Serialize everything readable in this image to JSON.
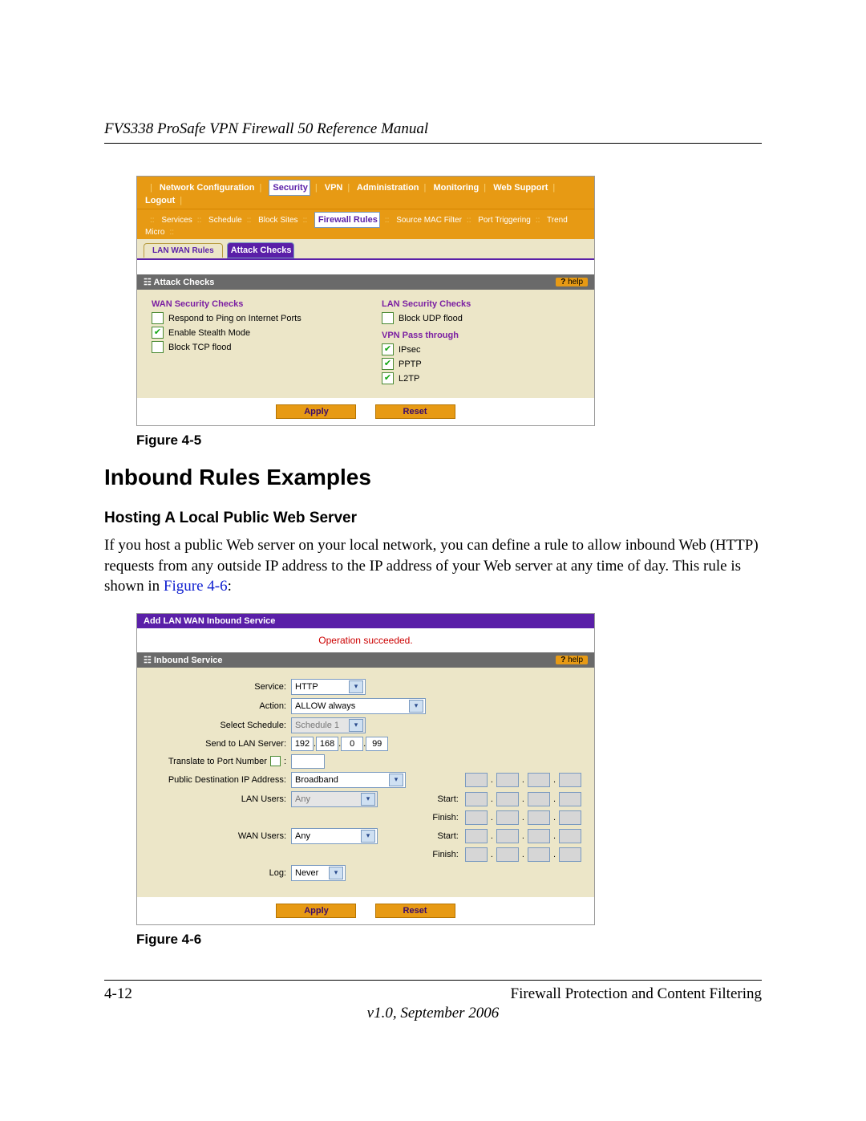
{
  "doc": {
    "running_head": "FVS338 ProSafe VPN Firewall 50 Reference Manual",
    "fig5_caption": "Figure 4-5",
    "section_head": "Inbound Rules Examples",
    "sub_head": "Hosting A Local Public Web Server",
    "body_text_pre": "If you host a public Web server on your local network, you can define a rule to allow inbound Web (HTTP) requests from any outside IP address to the IP address of your Web server at any time of day. This rule is shown in ",
    "body_text_xref": "Figure 4-6",
    "body_text_post": ":",
    "fig6_caption": "Figure 4-6",
    "pagenum": "4-12",
    "foot_right": "Firewall Protection and Content Filtering",
    "version": "v1.0, September 2006"
  },
  "fig5": {
    "nav1": [
      "Network Configuration",
      "Security",
      "VPN",
      "Administration",
      "Monitoring",
      "Web Support",
      "Logout"
    ],
    "nav1_selected": 1,
    "nav2": [
      "Services",
      "Schedule",
      "Block Sites",
      "Firewall Rules",
      "Source MAC Filter",
      "Port Triggering",
      "Trend Micro"
    ],
    "nav2_selected": 3,
    "tabs": [
      "LAN WAN Rules",
      "Attack Checks"
    ],
    "tab_selected": 1,
    "panel_title": "Attack Checks",
    "help_label": "help",
    "wan_head": "WAN Security Checks",
    "wan_checks": [
      {
        "label": "Respond to Ping on Internet Ports",
        "checked": false
      },
      {
        "label": "Enable Stealth Mode",
        "checked": true
      },
      {
        "label": "Block TCP flood",
        "checked": false
      }
    ],
    "lan_head": "LAN Security Checks",
    "lan_checks": [
      {
        "label": "Block UDP flood",
        "checked": false
      }
    ],
    "vpn_head": "VPN Pass through",
    "vpn_checks": [
      {
        "label": "IPsec",
        "checked": true
      },
      {
        "label": "PPTP",
        "checked": true
      },
      {
        "label": "L2TP",
        "checked": true
      }
    ],
    "apply": "Apply",
    "reset": "Reset"
  },
  "fig6": {
    "bar_title": "Add LAN WAN Inbound Service",
    "status": "Operation succeeded.",
    "panel_title": "Inbound Service",
    "help_label": "help",
    "rows": {
      "service": {
        "label": "Service:",
        "value": "HTTP"
      },
      "action": {
        "label": "Action:",
        "value": "ALLOW always"
      },
      "schedule": {
        "label": "Select Schedule:",
        "value": "Schedule 1",
        "disabled": true
      },
      "send_lbl": "Send to LAN Server:",
      "send_ip": [
        "192",
        "168",
        "0",
        "99"
      ],
      "translate_lbl": "Translate to Port Number",
      "translate_val": "",
      "pubdest": {
        "label": "Public Destination IP Address:",
        "value": "Broadband"
      },
      "lanusers": {
        "label": "LAN Users:",
        "value": "Any",
        "disabled": true
      },
      "wanusers": {
        "label": "WAN Users:",
        "value": "Any"
      },
      "log": {
        "label": "Log:",
        "value": "Never"
      },
      "start": "Start:",
      "finish": "Finish:"
    },
    "apply": "Apply",
    "reset": "Reset"
  }
}
